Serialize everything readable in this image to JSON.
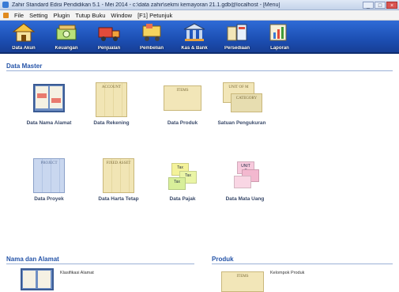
{
  "window": {
    "title": "Zahir Standard Edisi Pendidikan 5.1 - Mei 2014 - c:\\data zahir\\sekmi kemayoran 21.1.gdb@localhost - [Menu]",
    "buttons": [
      "_",
      "□",
      "×"
    ]
  },
  "menu": [
    "File",
    "Setting",
    "Plugin",
    "Tutup Buku",
    "Window",
    "[F1] Petunjuk"
  ],
  "toolbar": [
    {
      "label": "Data Akun",
      "icon": "house-icon"
    },
    {
      "label": "Keuangan",
      "icon": "money-icon"
    },
    {
      "label": "Penjualan",
      "icon": "truck-icon"
    },
    {
      "label": "Pembelian",
      "icon": "cart-icon"
    },
    {
      "label": "Kas & Bank",
      "icon": "bank-icon"
    },
    {
      "label": "Persediaan",
      "icon": "box-icon"
    },
    {
      "label": "Laporan",
      "icon": "chart-icon"
    }
  ],
  "data_master": {
    "title": "Data Master",
    "items": [
      {
        "label": "Data Nama Alamat",
        "icon": "address-book-icon"
      },
      {
        "label": "Data Rekening",
        "icon": "ledger-icon",
        "card": "ACCOUNT"
      },
      {
        "label": "Data Produk",
        "icon": "items-icon",
        "card": "ITEMS"
      },
      {
        "label": "Satuan Pengukuran",
        "icon": "unit-icon",
        "card": "UNIT OF M",
        "card2": "CATEGORY"
      },
      {
        "label": "Data Proyek",
        "icon": "project-icon",
        "card": "PROJECT"
      },
      {
        "label": "Data Harta Tetap",
        "icon": "asset-icon",
        "card": "FIXED ASSET"
      },
      {
        "label": "Data Pajak",
        "icon": "tax-icon",
        "card": "Tax"
      },
      {
        "label": "Data Mata Uang",
        "icon": "currency-icon",
        "card": "UNIT S"
      }
    ]
  },
  "nama_alamat": {
    "title": "Nama dan Alamat",
    "desc": "Klasifikasi Alamat"
  },
  "produk": {
    "title": "Produk",
    "desc": "Kelompok Produk",
    "card": "ITEMS"
  },
  "colors": {
    "toolbar": "#1c4fb3",
    "section_title": "#2554a8",
    "card": "#f2e6b8"
  }
}
